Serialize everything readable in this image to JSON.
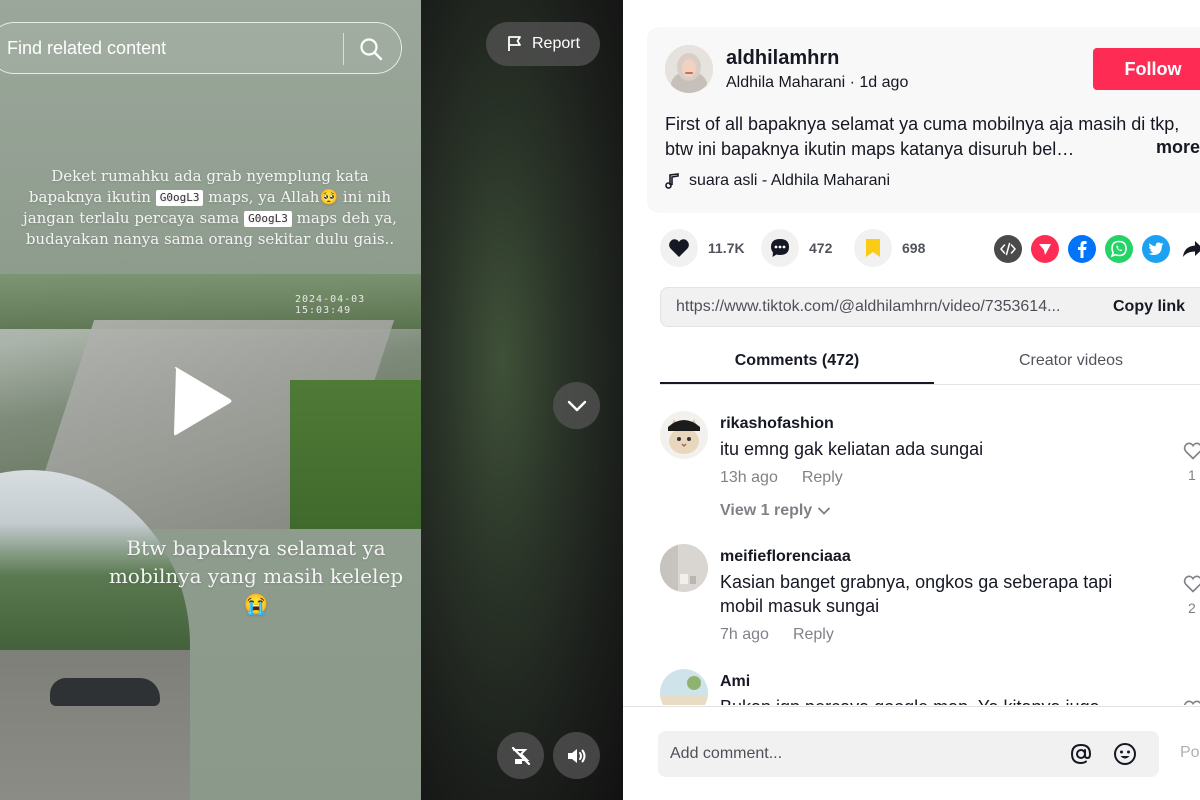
{
  "video": {
    "search_placeholder": "Find related content",
    "report_label": "Report",
    "caption_top": {
      "line1": "Deket rumahku ada grab nyemplung kata",
      "line2_a": "bapaknya ikutin ",
      "tag1": "G0ogL3",
      "line2_b": " maps, ya Allah🥺",
      "line2_c": " ini nih",
      "line3_a": "jangan terlalu percaya sama ",
      "tag2": "G0ogL3",
      "line3_b": " maps deh ya,",
      "line4": "budayakan nanya sama orang sekitar dulu gais.."
    },
    "caption_bottom": {
      "line1": "Btw bapaknya selamat ya",
      "line2": "mobilnya yang masih kelelep",
      "emoji": "😭"
    },
    "cctv_timestamp": "2024-04-03 15:03:49"
  },
  "post": {
    "username": "aldhilamhrn",
    "nickname": "Aldhila Maharani",
    "time_ago": "1d ago",
    "follow_label": "Follow",
    "description": "First of all bapaknya selamat ya cuma mobilnya aja masih di tkp, btw ini bapaknya ikutin maps katanya disuruh bel…",
    "more_label": "more",
    "music": "suara asli - Aldhila Maharani"
  },
  "actions": {
    "likes": "11.7K",
    "comments": "472",
    "saves": "698"
  },
  "share_icons": [
    "embed-icon",
    "send-icon",
    "facebook-icon",
    "whatsapp-icon",
    "twitter-icon",
    "share-arrow-icon"
  ],
  "link": {
    "url": "https://www.tiktok.com/@aldhilamhrn/video/7353614...",
    "copy_label": "Copy link"
  },
  "tabs": {
    "comments": "Comments (472)",
    "creator": "Creator videos"
  },
  "comments": [
    {
      "user": "rikashofashion",
      "text": "itu emng gak keliatan ada sungai",
      "time": "13h ago",
      "reply_label": "Reply",
      "likes": "1",
      "view_replies": "View 1 reply"
    },
    {
      "user": "meifieflorenciaaa",
      "text": "Kasian banget grabnya, ongkos ga seberapa tapi mobil masuk sungai",
      "time": "7h ago",
      "reply_label": "Reply",
      "likes": "2"
    },
    {
      "user": "Ami",
      "text": "Bukan jgn percaya google map. Ya kitanya juga"
    }
  ],
  "comment_bar": {
    "placeholder": "Add comment...",
    "post_label": "Po"
  },
  "colors": {
    "accent": "#fe2c55",
    "facebook": "#0075fa",
    "whatsapp": "#25d366",
    "twitter": "#1da1f2"
  }
}
